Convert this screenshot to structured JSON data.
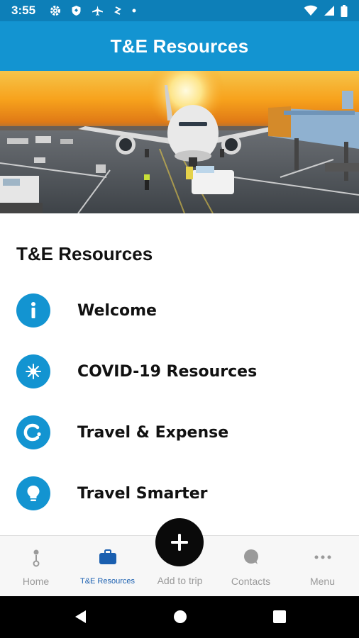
{
  "status_bar": {
    "time": "3:55",
    "left_icons": [
      "gear-icon",
      "shield-icon",
      "airplane-icon",
      "nfc-icon",
      "dot-icon"
    ],
    "right_icons": [
      "wifi-icon",
      "signal-icon",
      "battery-icon"
    ]
  },
  "header": {
    "title": "T&E Resources"
  },
  "hero": {
    "image": "airplane-at-gate-sunset"
  },
  "section": {
    "title": "T&E Resources"
  },
  "resources": [
    {
      "label": "Welcome",
      "icon": "info-icon"
    },
    {
      "label": "COVID-19 Resources",
      "icon": "virus-icon"
    },
    {
      "label": "Travel & Expense",
      "icon": "brand-c-icon"
    },
    {
      "label": "Travel Smarter",
      "icon": "lightbulb-icon"
    }
  ],
  "bottom_nav": {
    "items": [
      {
        "label": "Home",
        "icon": "home-pin-icon",
        "active": false
      },
      {
        "label": "T&E Resources",
        "icon": "briefcase-icon",
        "active": true
      },
      {
        "label": "Add to trip",
        "icon": "plus-icon",
        "active": false
      },
      {
        "label": "Contacts",
        "icon": "chat-bubble-icon",
        "active": false
      },
      {
        "label": "Menu",
        "icon": "more-dots-icon",
        "active": false
      }
    ]
  },
  "colors": {
    "status_bar": "#0d7fb8",
    "header": "#1394d1",
    "accent": "#1394d1",
    "active_nav": "#1a5fb0",
    "fab": "#0a0a0a"
  }
}
